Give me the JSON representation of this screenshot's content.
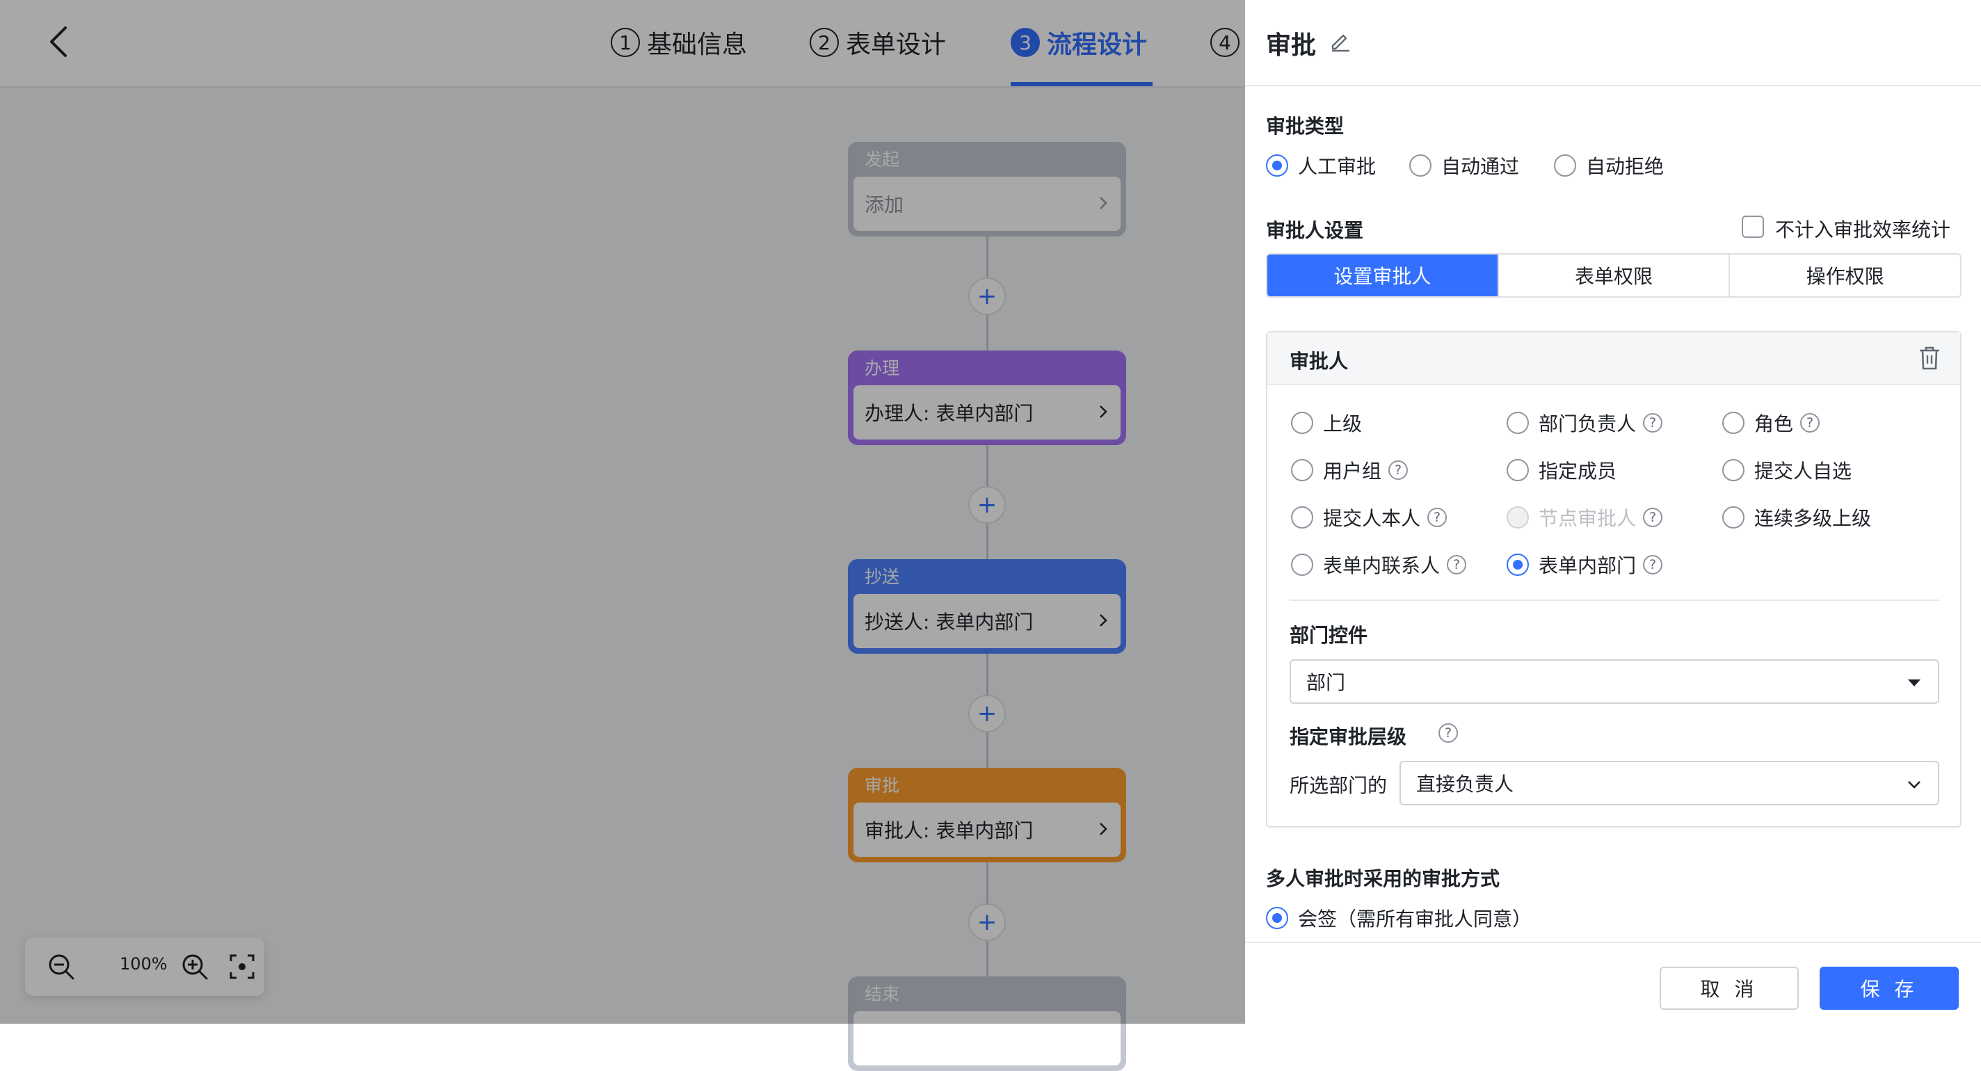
{
  "header": {
    "back_icon": "chevron-left-icon",
    "steps": [
      {
        "num": "1",
        "label": "基础信息"
      },
      {
        "num": "2",
        "label": "表单设计"
      },
      {
        "num": "3",
        "label": "流程设计"
      },
      {
        "num": "4",
        "label": ""
      }
    ],
    "active_step": 3
  },
  "flow": {
    "nodes": [
      {
        "type": "start",
        "title": "发起",
        "text": "添加",
        "color": "#8f959e"
      },
      {
        "type": "handle",
        "title": "办理",
        "text": "办理人: 表单内部门",
        "color": "#7f3bf5"
      },
      {
        "type": "cc",
        "title": "抄送",
        "text": "抄送人: 表单内部门",
        "color": "#3370ff"
      },
      {
        "type": "approve",
        "title": "审批",
        "text": "审批人: 表单内部门",
        "color": "#ff8800"
      },
      {
        "type": "end",
        "title": "结束",
        "text": "",
        "color": "#8f959e"
      }
    ],
    "add_symbol": "+"
  },
  "zoom": {
    "level": "100%"
  },
  "drawer": {
    "title": "审批",
    "approval_type": {
      "label": "审批类型",
      "options": [
        "人工审批",
        "自动通过",
        "自动拒绝"
      ],
      "selected": "人工审批"
    },
    "approver_settings": {
      "label": "审批人设置",
      "no_stats_label": "不计入审批效率统计",
      "no_stats_checked": false,
      "tabs": [
        "设置审批人",
        "表单权限",
        "操作权限"
      ],
      "active_tab": "设置审批人"
    },
    "approver_card": {
      "title": "审批人",
      "options": [
        {
          "label": "上级",
          "help": false,
          "disabled": false
        },
        {
          "label": "部门负责人",
          "help": true,
          "disabled": false
        },
        {
          "label": "角色",
          "help": true,
          "disabled": false
        },
        {
          "label": "用户组",
          "help": true,
          "disabled": false
        },
        {
          "label": "指定成员",
          "help": false,
          "disabled": false
        },
        {
          "label": "提交人自选",
          "help": false,
          "disabled": false
        },
        {
          "label": "提交人本人",
          "help": true,
          "disabled": false
        },
        {
          "label": "节点审批人",
          "help": true,
          "disabled": true
        },
        {
          "label": "连续多级上级",
          "help": false,
          "disabled": false
        },
        {
          "label": "表单内联系人",
          "help": true,
          "disabled": false
        },
        {
          "label": "表单内部门",
          "help": true,
          "disabled": false
        }
      ],
      "selected": "表单内部门",
      "dept_control": {
        "label": "部门控件",
        "value": "部门"
      },
      "level": {
        "label": "指定审批层级",
        "prefix": "所选部门的",
        "value": "直接负责人"
      }
    },
    "multi_approve": {
      "label": "多人审批时采用的审批方式",
      "option": "会签（需所有审批人同意）",
      "selected": true
    },
    "footer": {
      "cancel": "取 消",
      "save": "保 存"
    }
  },
  "colors": {
    "accent": "#3370ff"
  }
}
